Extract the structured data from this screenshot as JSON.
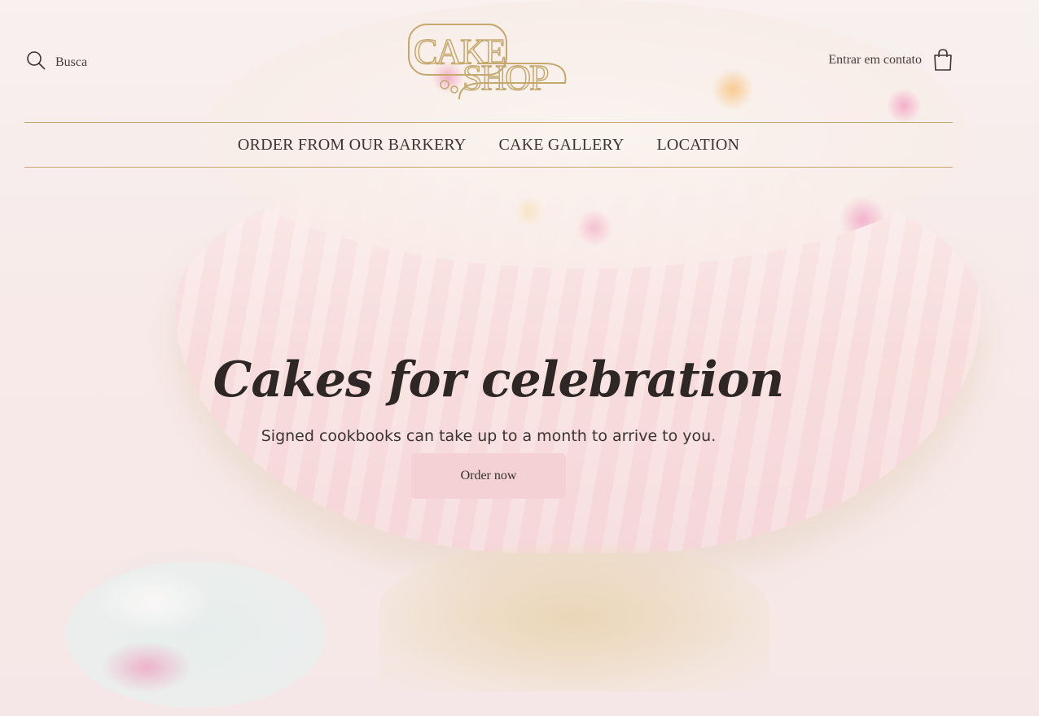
{
  "header": {
    "search_label": "Busca",
    "logo_line1": "CAKE",
    "logo_line2": "SHOP",
    "contact_label": "Entrar em contato"
  },
  "nav": {
    "items": [
      {
        "label": "ORDER FROM OUR BARKERY"
      },
      {
        "label": "CAKE GALLERY"
      },
      {
        "label": "LOCATION"
      }
    ]
  },
  "hero": {
    "title": "Cakes for celebration",
    "subtitle": "Signed cookbooks can take up to a month to arrive to you.",
    "cta_label": "Order now"
  },
  "icons": {
    "search": "search-icon",
    "cart": "shopping-bag-icon"
  },
  "colors": {
    "accent_gold": "#c5a86e",
    "button_pink": "#f3d1d4",
    "text_dark": "#3d3432"
  }
}
